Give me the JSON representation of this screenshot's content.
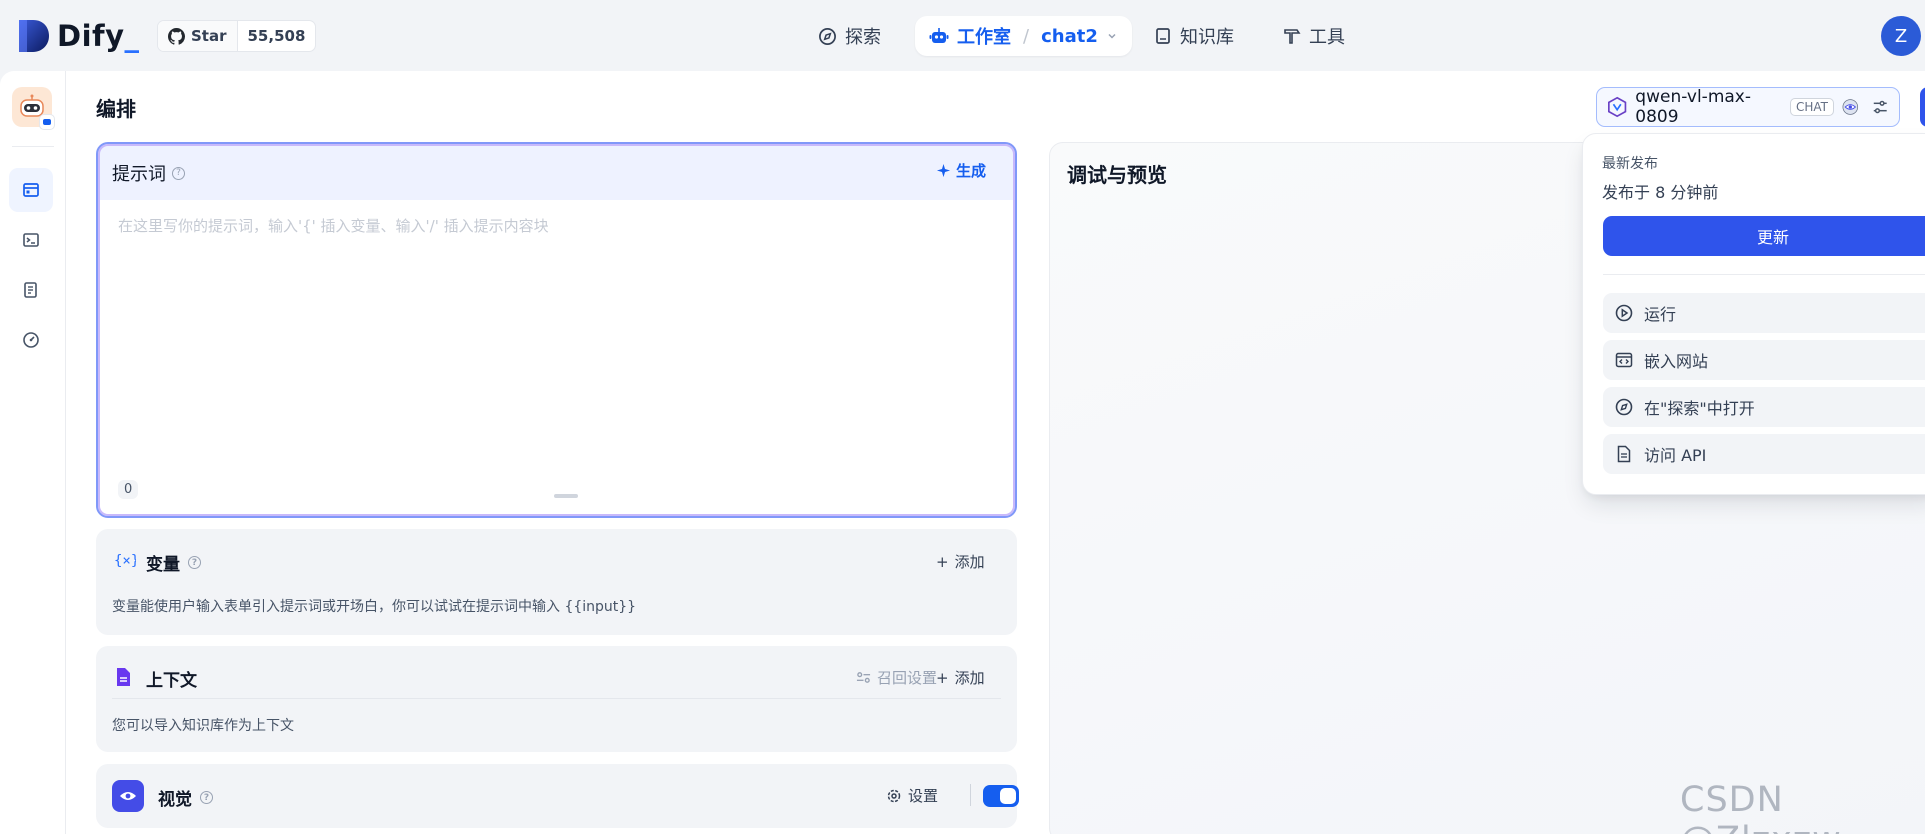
{
  "brand": {
    "name": "Dify",
    "dot": "_"
  },
  "github": {
    "star_label": "Star",
    "count": "55,508"
  },
  "nav": {
    "explore": "探索",
    "studio": "工作室",
    "current_app": "chat2",
    "knowledge": "知识库",
    "tools": "工具"
  },
  "user": {
    "initial": "Z"
  },
  "page": {
    "title": "编排"
  },
  "model": {
    "name": "qwen-vl-max-0809",
    "mode_tag": "CHAT"
  },
  "prompt": {
    "title": "提示词",
    "generate": "生成",
    "placeholder": "在这里写你的提示词，输入'{' 插入变量、输入'/' 插入提示内容块",
    "char_count": "0"
  },
  "variables": {
    "title": "变量",
    "add": "添加",
    "description": "变量能使用户输入表单引入提示词或开场白，你可以试试在提示词中输入 {{input}}"
  },
  "context": {
    "title": "上下文",
    "recall": "召回设置",
    "add": "添加",
    "description": "您可以导入知识库作为上下文"
  },
  "vision": {
    "title": "视觉",
    "settings": "设置",
    "enabled": true
  },
  "debug": {
    "title": "调试与预览"
  },
  "publish": {
    "label": "最新发布",
    "time": "发布于 8 分钟前",
    "update": "更新",
    "items": [
      "运行",
      "嵌入网站",
      "在\"探索\"中打开",
      "访问 API"
    ]
  },
  "watermark": "CSDN @Zlzxzw",
  "colors": {
    "primary": "#155eef",
    "publish_button": "#2f54eb",
    "vision_icon": "#444ce7"
  }
}
